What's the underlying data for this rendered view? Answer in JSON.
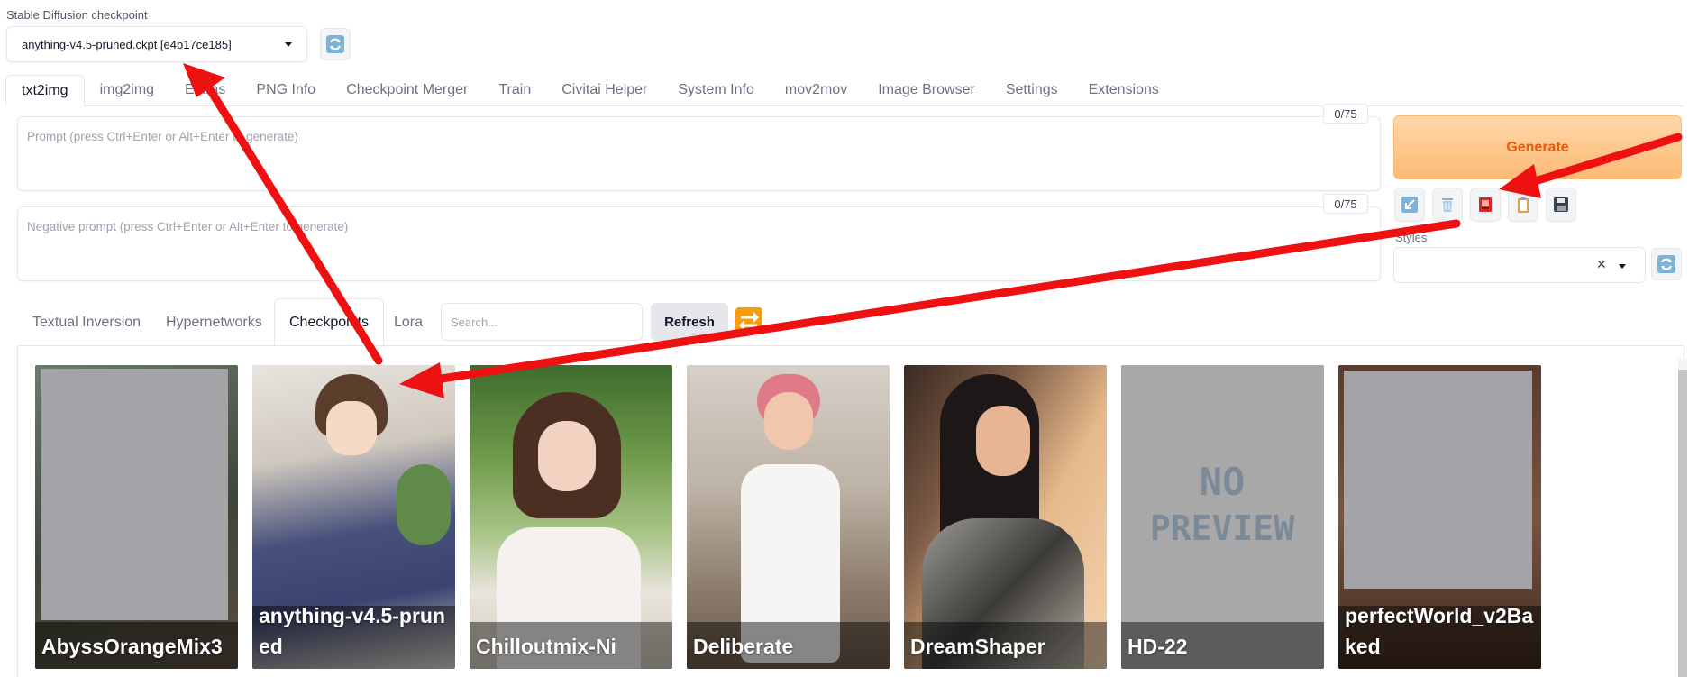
{
  "checkpoint": {
    "label": "Stable Diffusion checkpoint",
    "value": "anything-v4.5-pruned.ckpt [e4b17ce185]"
  },
  "tabs": [
    "txt2img",
    "img2img",
    "Extras",
    "PNG Info",
    "Checkpoint Merger",
    "Train",
    "Civitai Helper",
    "System Info",
    "mov2mov",
    "Image Browser",
    "Settings",
    "Extensions"
  ],
  "prompt": {
    "placeholder": "Prompt (press Ctrl+Enter or Alt+Enter to generate)",
    "counter": "0/75"
  },
  "negative_prompt": {
    "placeholder": "Negative prompt (press Ctrl+Enter or Alt+Enter to generate)",
    "counter": "0/75"
  },
  "generate_label": "Generate",
  "styles_label": "Styles",
  "subtabs": [
    "Textual Inversion",
    "Hypernetworks",
    "Checkpoints",
    "Lora"
  ],
  "search_placeholder": "Search...",
  "refresh_label": "Refresh",
  "cards": [
    {
      "name": "AbyssOrangeMix3"
    },
    {
      "name": "anything-v4.5-pruned"
    },
    {
      "name": "Chilloutmix-Ni"
    },
    {
      "name": "Deliberate"
    },
    {
      "name": "DreamShaper"
    },
    {
      "name": "HD-22",
      "image_text": "NO PREVIEW"
    },
    {
      "name": "perfectWorld_v2Baked"
    }
  ],
  "colors": {
    "generate": "#fdba74",
    "arrow": "#ee1111",
    "accent_orange": "#ea580c"
  }
}
